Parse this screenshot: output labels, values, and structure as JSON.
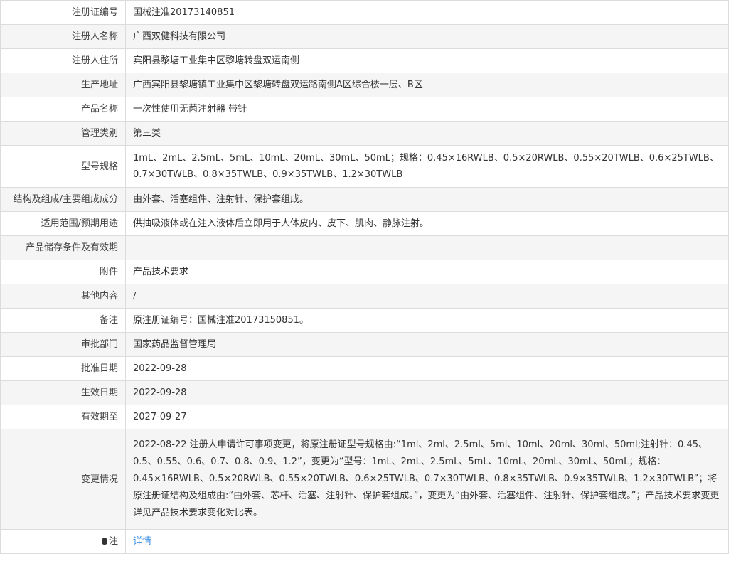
{
  "rows": [
    {
      "label": "注册证编号",
      "value": "国械注准20173140851"
    },
    {
      "label": "注册人名称",
      "value": "广西双健科技有限公司"
    },
    {
      "label": "注册人住所",
      "value": "宾阳县黎塘工业集中区黎塘转盘双运南侧"
    },
    {
      "label": "生产地址",
      "value": "广西宾阳县黎塘镇工业集中区黎塘转盘双运路南侧A区综合楼一层、B区"
    },
    {
      "label": "产品名称",
      "value": "一次性使用无菌注射器 带针"
    },
    {
      "label": "管理类别",
      "value": "第三类"
    },
    {
      "label": "型号规格",
      "value": "1mL、2mL、2.5mL、5mL、10mL、20mL、30mL、50mL；规格：0.45×16RWLB、0.5×20RWLB、0.55×20TWLB、0.6×25TWLB、0.7×30TWLB、0.8×35TWLB、0.9×35TWLB、1.2×30TWLB"
    },
    {
      "label": "结构及组成/主要组成成分",
      "value": "由外套、活塞组件、注射针、保护套组成。"
    },
    {
      "label": "适用范围/预期用途",
      "value": "供抽吸液体或在注入液体后立即用于人体皮内、皮下、肌肉、静脉注射。"
    },
    {
      "label": "产品储存条件及有效期",
      "value": ""
    },
    {
      "label": "附件",
      "value": "产品技术要求"
    },
    {
      "label": "其他内容",
      "value": "/"
    },
    {
      "label": "备注",
      "value": "原注册证编号：国械注准20173150851。"
    },
    {
      "label": "审批部门",
      "value": "国家药品监督管理局"
    },
    {
      "label": "批准日期",
      "value": "2022-09-28"
    },
    {
      "label": "生效日期",
      "value": "2022-09-28"
    },
    {
      "label": "有效期至",
      "value": "2027-09-27"
    },
    {
      "label": "变更情况",
      "value": "2022-08-22 注册人申请许可事项变更，将原注册证型号规格由:“1ml、2ml、2.5ml、5ml、10ml、20ml、30ml、50ml;注射针：0.45、0.5、0.55、0.6、0.7、0.8、0.9、1.2”，变更为“型号：1mL、2mL、2.5mL、5mL、10mL、20mL、30mL、50mL；规格：0.45×16RWLB、0.5×20RWLB、0.55×20TWLB、0.6×25TWLB、0.7×30TWLB、0.8×35TWLB、0.9×35TWLB、1.2×30TWLB”；将原注册证结构及组成由:“由外套、芯杆、活塞、注射针、保护套组成。”，变更为“由外套、活塞组件、注射针、保护套组成。”；产品技术要求变更详见产品技术要求变化对比表。"
    }
  ],
  "note": {
    "label": "注",
    "link": "详情",
    "icon": "lightbulb-icon"
  }
}
